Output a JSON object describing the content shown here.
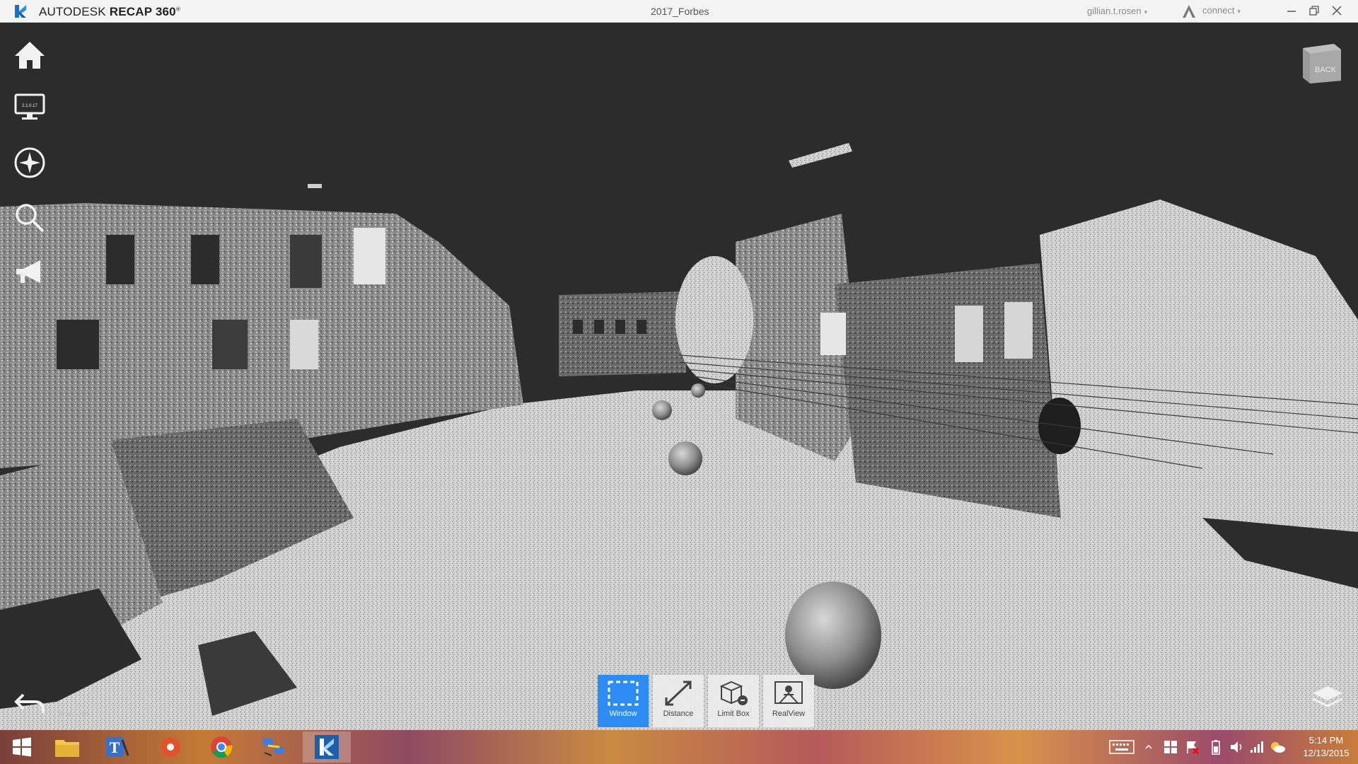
{
  "titlebar": {
    "brand_prefix": "AUTODESK",
    "brand_product": "RECAP 360",
    "brand_mark": "®",
    "document_title": "2017_Forbes",
    "user": "gillian.t.rosen",
    "connect_label": "connect",
    "caret": "▾"
  },
  "left_tools": [
    {
      "icon": "home-icon"
    },
    {
      "icon": "display-icon",
      "screen_text": "2.1.0.17"
    },
    {
      "icon": "navigation-icon"
    },
    {
      "icon": "search-icon"
    },
    {
      "icon": "megaphone-icon"
    }
  ],
  "viewcube": {
    "label": "BACK"
  },
  "toolbar": {
    "tools": [
      {
        "label": "Window",
        "active": true
      },
      {
        "label": "Distance",
        "active": false
      },
      {
        "label": "Limit Box",
        "active": false
      },
      {
        "label": "RealView",
        "active": false
      }
    ]
  },
  "status": {
    "coords": "x: - m"
  },
  "taskbar": {
    "time": "5:14 PM",
    "date": "12/13/2015"
  },
  "colors": {
    "accent": "#2c8cf4",
    "viewport_bg": "#2c2c2c",
    "titlebar_bg": "#f4f4f4"
  }
}
